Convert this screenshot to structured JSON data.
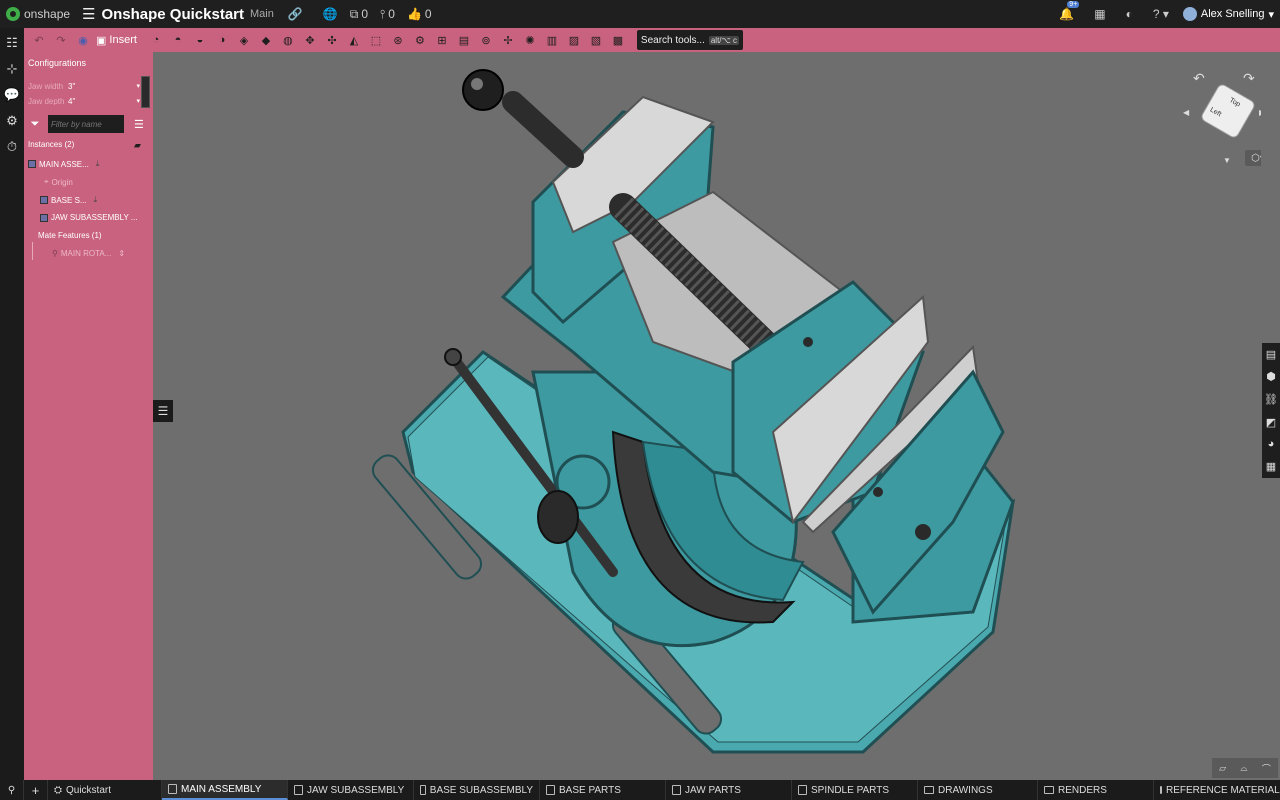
{
  "topbar": {
    "app_name": "onshape",
    "document_title": "Onshape Quickstart",
    "branch": "Main",
    "versions_count": "0",
    "branches_count": "0",
    "likes_count": "0",
    "notification_badge": "9+",
    "user_name": "Alex Snelling"
  },
  "toolbar": {
    "insert_label": "Insert",
    "search_label": "Search tools...",
    "search_shortcut": "alt/⌥ c"
  },
  "panel": {
    "configurations_title": "Configurations",
    "configs": [
      {
        "label": "Jaw width",
        "value": "3\""
      },
      {
        "label": "Jaw depth",
        "value": "4\""
      }
    ],
    "filter_placeholder": "Filter by name",
    "instances_title": "Instances (2)",
    "tree": [
      {
        "label": "MAIN ASSE...",
        "indent": 0
      },
      {
        "label": "Origin",
        "indent": 2
      },
      {
        "label": "BASE S...",
        "indent": 1
      },
      {
        "label": "JAW SUBASSEMBLY ...",
        "indent": 1
      },
      {
        "label": "Mate Features (1)",
        "indent": 1
      },
      {
        "label": "MAIN ROTA...",
        "indent": 3
      }
    ]
  },
  "viewcube": {
    "top_label": "Top",
    "left_label": "Left"
  },
  "tabs": [
    {
      "label": "Quickstart",
      "kind": "workspace"
    },
    {
      "label": "MAIN ASSEMBLY",
      "kind": "assembly",
      "active": true
    },
    {
      "label": "JAW SUBASSEMBLY",
      "kind": "assembly"
    },
    {
      "label": "BASE SUBASSEMBLY",
      "kind": "assembly"
    },
    {
      "label": "BASE PARTS",
      "kind": "partstudio"
    },
    {
      "label": "JAW PARTS",
      "kind": "partstudio"
    },
    {
      "label": "SPINDLE PARTS",
      "kind": "partstudio"
    },
    {
      "label": "DRAWINGS",
      "kind": "folder"
    },
    {
      "label": "RENDERS",
      "kind": "folder"
    },
    {
      "label": "REFERENCE MATERIAL",
      "kind": "folder"
    }
  ],
  "colors": {
    "accent_panel": "#c9627f",
    "model_teal": "#3d9aa0",
    "viewport_bg": "#6e6e6e"
  }
}
